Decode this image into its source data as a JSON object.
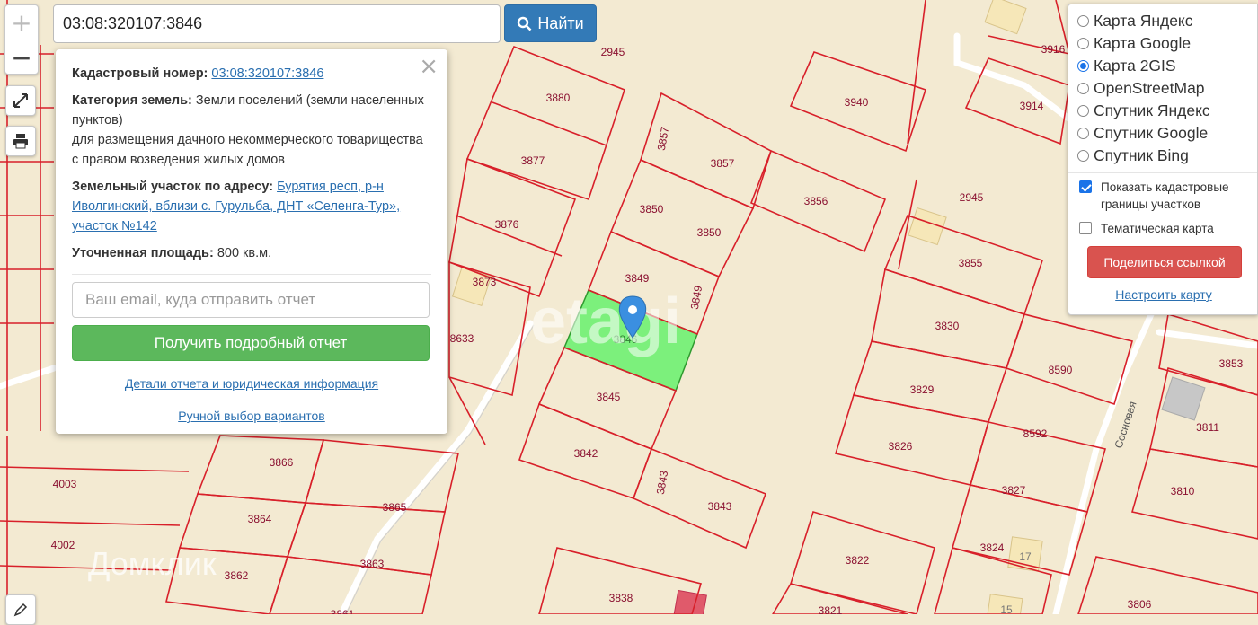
{
  "search": {
    "value": "03:08:320107:3846",
    "button_label": "Найти"
  },
  "zoom": {
    "in": "+",
    "out": "−"
  },
  "popup": {
    "close": "×",
    "cadastral_label": "Кадастровый номер:",
    "cadastral_value": "03:08:320107:3846",
    "category_label": "Категория земель:",
    "category_value": "Земли поселений (земли населенных пунктов)",
    "category_use": "для размещения дачного некоммерческого товарищества с правом возведения жилых домов",
    "address_label": "Земельный участок по адресу:",
    "address_value": "Бурятия респ, р-н Иволгинский, вблизи с. Гурульба, ДНТ «Селенга-Тур», участок №142",
    "area_label": "Уточненная площадь:",
    "area_value": "800 кв.м.",
    "email_placeholder": "Ваш email, куда отправить отчет",
    "report_button": "Получить подробный отчет",
    "details_link": "Детали отчета и юридическая информация",
    "manual_link": "Ручной выбор вариантов"
  },
  "layers": {
    "base": [
      {
        "label": "Карта Яндекс",
        "selected": false
      },
      {
        "label": "Карта Google",
        "selected": false
      },
      {
        "label": "Карта 2GIS",
        "selected": true
      },
      {
        "label": "OpenStreetMap",
        "selected": false
      },
      {
        "label": "Спутник Яндекс",
        "selected": false
      },
      {
        "label": "Спутник Google",
        "selected": false
      },
      {
        "label": "Спутник Bing",
        "selected": false
      }
    ],
    "show_boundaries": {
      "label": "Показать кадастровые границы участков",
      "checked": true
    },
    "thematic": {
      "label": "Тематическая карта",
      "checked": false
    },
    "share_button": "Поделиться ссылкой",
    "configure_link": "Настроить карту"
  },
  "map": {
    "street_label": "Сосновая",
    "watermarks": [
      "etagi",
      "Домклик"
    ],
    "selected_parcel": "3846",
    "parcel_labels": [
      "2945",
      "3916",
      "3880",
      "3940",
      "3914",
      "3857",
      "3857",
      "3877",
      "3850",
      "3856",
      "2945",
      "3876",
      "3850",
      "3855",
      "3873",
      "3849",
      "3849",
      "3830",
      "8633",
      "3846",
      "8590",
      "3853",
      "3829",
      "3845",
      "3811",
      "3842",
      "3826",
      "8592",
      "4003",
      "3866",
      "3843",
      "3827",
      "3810",
      "3865",
      "3843",
      "3864",
      "4002",
      "3824",
      "17",
      "3863",
      "3822",
      "3862",
      "3838",
      "3821",
      "3861",
      "15",
      "3806"
    ]
  },
  "colors": {
    "parcel_line": "#d8202a",
    "selected_fill": "#7cf07c",
    "map_bg": "#f3ead2",
    "label": "#8a1030"
  }
}
